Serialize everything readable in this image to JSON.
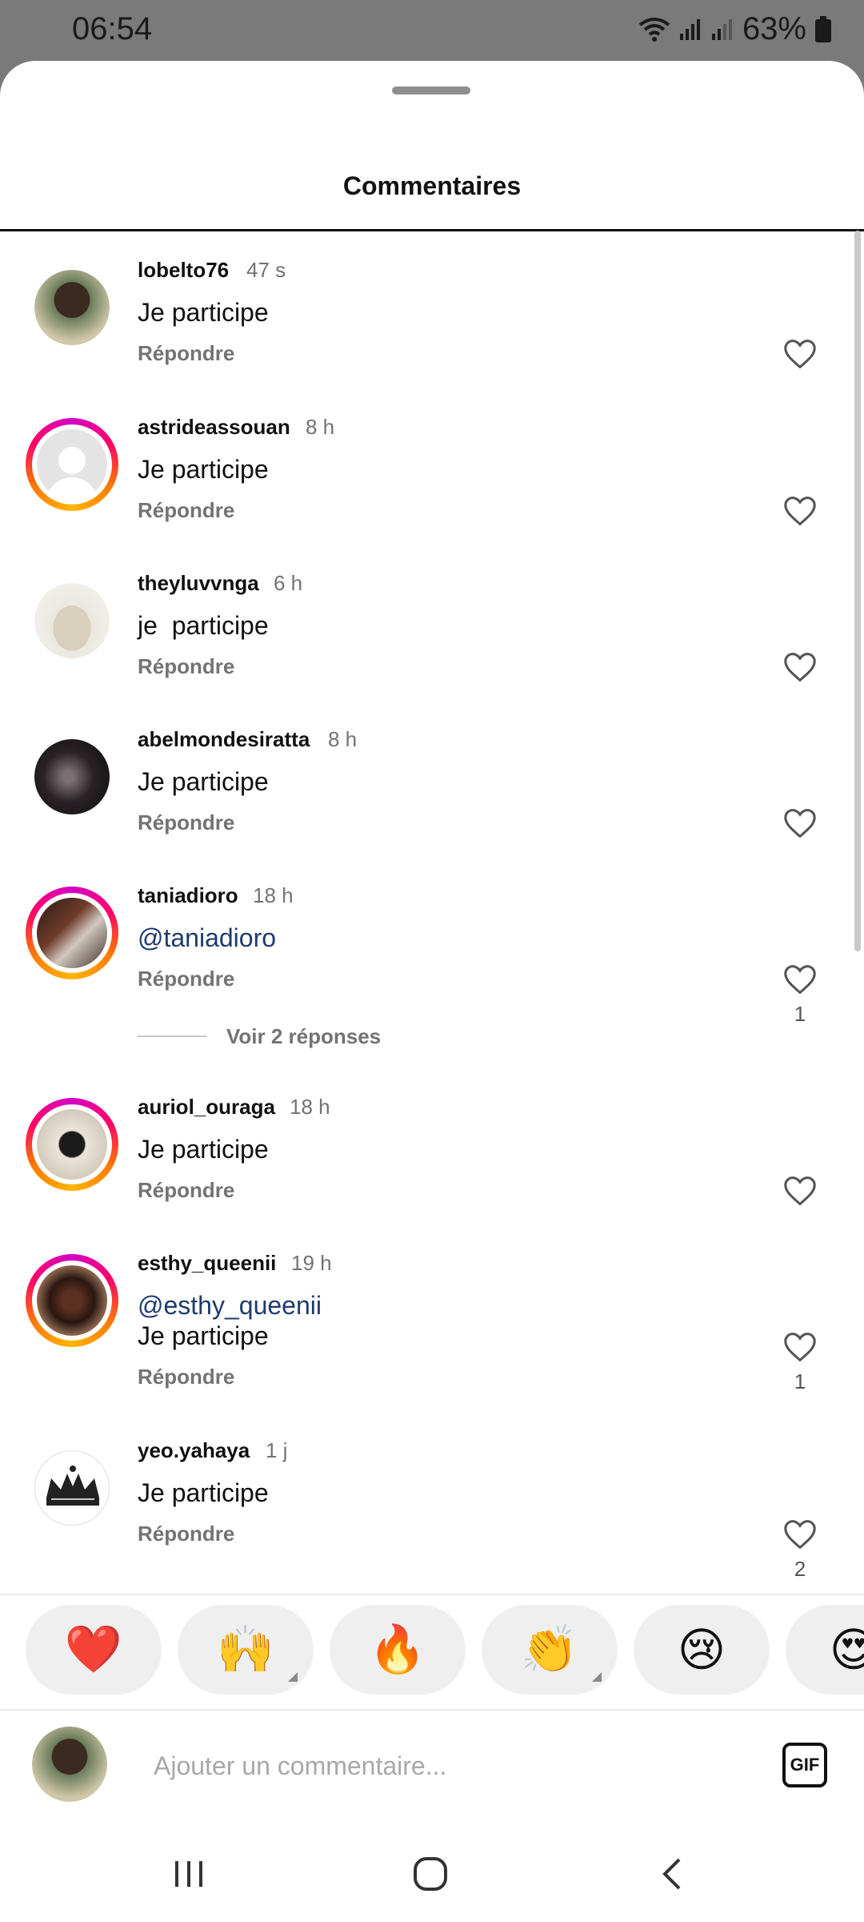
{
  "status_bar": {
    "time": "06:54",
    "battery": "63%"
  },
  "sheet": {
    "title": "Commentaires"
  },
  "comments": [
    {
      "username": "lobelto76",
      "time": "47 s",
      "text": "Je participe",
      "reply": "Répondre",
      "likes": ""
    },
    {
      "username": "astrideassouan",
      "time": "8 h",
      "text": "Je participe",
      "reply": "Répondre",
      "likes": ""
    },
    {
      "username": "theyluvvnga",
      "time": "6 h",
      "text": "je  participe",
      "reply": "Répondre",
      "likes": ""
    },
    {
      "username": "abelmondesiratta",
      "time": "8 h",
      "text": "Je participe",
      "reply": "Répondre",
      "likes": ""
    },
    {
      "username": "taniadioro",
      "time": "18 h",
      "mention": "@taniadioro",
      "reply": "Répondre",
      "likes": "1",
      "view_replies": "Voir 2 réponses"
    },
    {
      "username": "auriol_ouraga",
      "time": "18 h",
      "text": "Je participe",
      "reply": "Répondre",
      "likes": ""
    },
    {
      "username": "esthy_queenii",
      "time": "19 h",
      "mention": "@esthy_queenii",
      "text": "Je participe",
      "reply": "Répondre",
      "likes": "1"
    },
    {
      "username": "yeo.yahaya",
      "time": "1 j",
      "text": "Je participe",
      "reply": "Répondre",
      "likes": "2"
    }
  ],
  "emoji_reactions": [
    "❤️",
    "🙌",
    "🔥",
    "👏",
    "😢",
    "😍"
  ],
  "composer": {
    "placeholder": "Ajouter un commentaire...",
    "gif_label": "GIF"
  }
}
